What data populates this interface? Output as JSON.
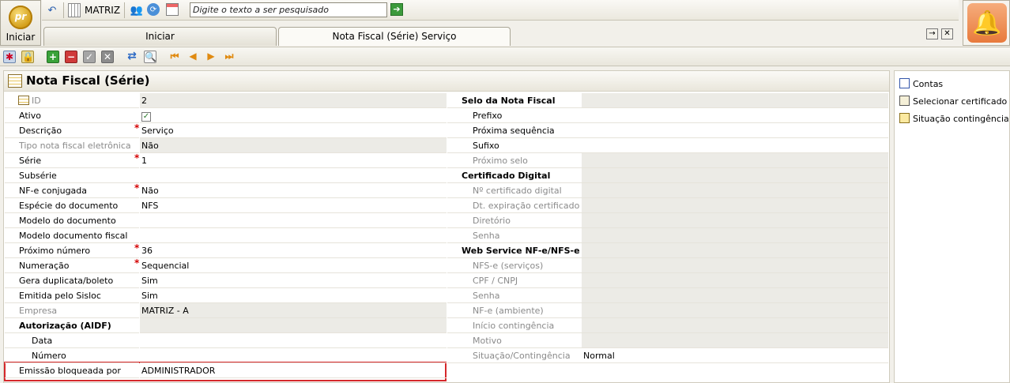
{
  "start": {
    "label": "Iniciar",
    "logo": "pr"
  },
  "topbar": {
    "branch": "MATRIZ",
    "search_placeholder": "Digite o texto a ser pesquisado"
  },
  "tabs": [
    {
      "label": "Iniciar"
    },
    {
      "label": "Nota Fiscal (Série) Serviço"
    }
  ],
  "panel": {
    "title": "Nota Fiscal (Série)"
  },
  "left_fields": [
    {
      "label": "ID",
      "value": "2"
    },
    {
      "label": "Ativo",
      "value": "✓"
    },
    {
      "label": "Descrição",
      "value": "Serviço"
    },
    {
      "label": "Tipo nota fiscal eletrônica",
      "value": "Não"
    },
    {
      "label": "Série",
      "value": "1"
    },
    {
      "label": "Subsérie",
      "value": ""
    },
    {
      "label": "NF-e conjugada",
      "value": "Não"
    },
    {
      "label": "Espécie do documento",
      "value": "NFS"
    },
    {
      "label": "Modelo do documento",
      "value": ""
    },
    {
      "label": "Modelo documento fiscal",
      "value": ""
    },
    {
      "label": "Próximo número",
      "value": "36"
    },
    {
      "label": "Numeração",
      "value": "Sequencial"
    },
    {
      "label": "Gera duplicata/boleto",
      "value": "Sim"
    },
    {
      "label": "Emitida pelo Sisloc",
      "value": "Sim"
    },
    {
      "label": "Empresa",
      "value": "MATRIZ - A"
    },
    {
      "label": "Autorização (AIDF)",
      "value": ""
    },
    {
      "label": "Data",
      "value": ""
    },
    {
      "label": "Número",
      "value": ""
    },
    {
      "label": "Emissão bloqueada por",
      "value": "ADMINISTRADOR"
    }
  ],
  "right_fields": [
    {
      "label": "Selo da Nota Fiscal",
      "value": ""
    },
    {
      "label": "Prefixo",
      "value": ""
    },
    {
      "label": "Próxima sequência",
      "value": ""
    },
    {
      "label": "Sufixo",
      "value": ""
    },
    {
      "label": "Próximo selo",
      "value": ""
    },
    {
      "label": "Certificado Digital",
      "value": ""
    },
    {
      "label": "Nº certificado digital",
      "value": ""
    },
    {
      "label": "Dt. expiração certificado",
      "value": ""
    },
    {
      "label": "Diretório",
      "value": ""
    },
    {
      "label": "Senha",
      "value": ""
    },
    {
      "label": "Web Service NF-e/NFS-e",
      "value": ""
    },
    {
      "label": "NFS-e (serviços)",
      "value": ""
    },
    {
      "label": "CPF / CNPJ",
      "value": ""
    },
    {
      "label": "Senha",
      "value": ""
    },
    {
      "label": "NF-e (ambiente)",
      "value": ""
    },
    {
      "label": "Início contingência",
      "value": ""
    },
    {
      "label": "Motivo",
      "value": ""
    },
    {
      "label": "Situação/Contingência",
      "value": "Normal"
    }
  ],
  "side_actions": [
    {
      "label": "Contas"
    },
    {
      "label": "Selecionar certificado"
    },
    {
      "label": "Situação contingência"
    }
  ]
}
